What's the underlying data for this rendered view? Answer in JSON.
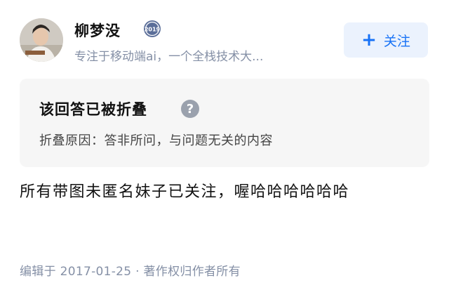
{
  "author": {
    "name": "柳梦没",
    "badge_year": "2019",
    "bio": "专注于移动端ai，一个全栈技术大..."
  },
  "follow_button": {
    "icon": "plus-icon",
    "label": "关注"
  },
  "folded_notice": {
    "title": "该回答已被折叠",
    "help_icon": "question-icon",
    "reason": "折叠原因：答非所问，与问题无关的内容"
  },
  "answer": {
    "text": "所有带图未匿名妹子已关注，喔哈哈哈哈哈哈"
  },
  "meta": {
    "edit_info": "编辑于 2017-01-25 · 著作权归作者所有"
  },
  "colors": {
    "accent": "#1772f6",
    "follow_bg": "#ebf2fd",
    "muted_text": "#8590a6",
    "folded_bg": "#f6f6f6"
  }
}
